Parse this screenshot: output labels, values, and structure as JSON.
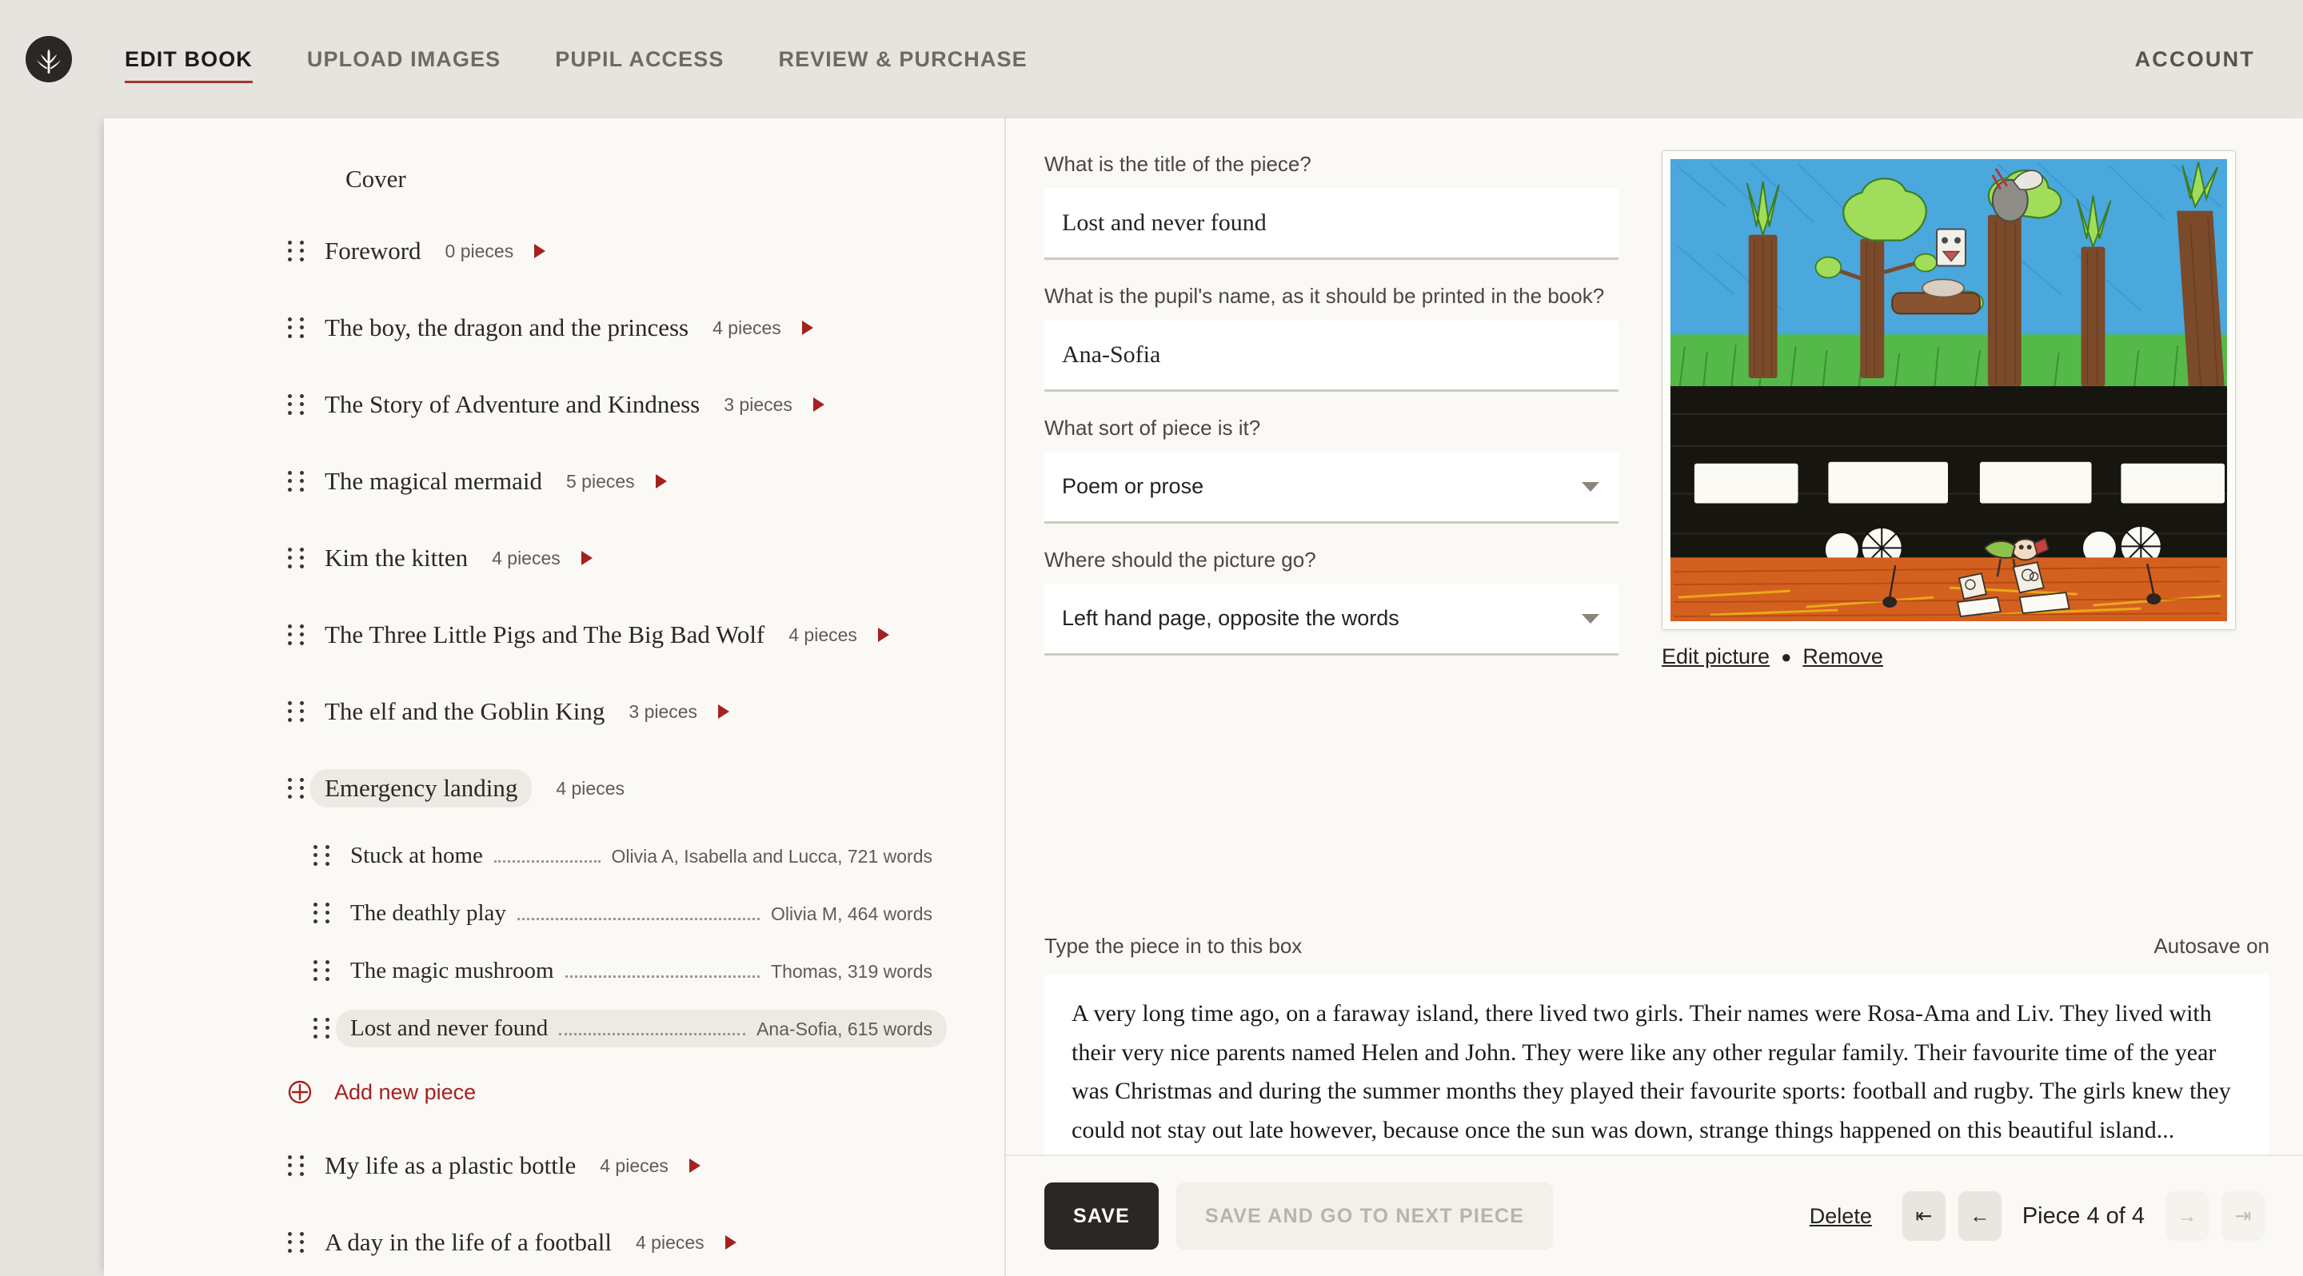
{
  "brand": {
    "logo_icon": "wheat-sheaf-logo"
  },
  "nav": {
    "items": [
      {
        "label": "EDIT BOOK",
        "active": true
      },
      {
        "label": "UPLOAD IMAGES",
        "active": false
      },
      {
        "label": "PUPIL ACCESS",
        "active": false
      },
      {
        "label": "REVIEW & PURCHASE",
        "active": false
      }
    ],
    "account_label": "ACCOUNT"
  },
  "sidebar": {
    "cover_label": "Cover",
    "add_piece_label": "Add new piece",
    "chapters": [
      {
        "title": "Foreword",
        "count": "0 pieces",
        "expanded": false,
        "selected": false
      },
      {
        "title": "The boy, the dragon and the princess",
        "count": "4 pieces",
        "expanded": false,
        "selected": false
      },
      {
        "title": "The Story of Adventure and Kindness",
        "count": "3 pieces",
        "expanded": false,
        "selected": false
      },
      {
        "title": "The magical mermaid",
        "count": "5 pieces",
        "expanded": false,
        "selected": false
      },
      {
        "title": "Kim the kitten",
        "count": "4 pieces",
        "expanded": false,
        "selected": false
      },
      {
        "title": "The Three Little Pigs and The Big Bad Wolf",
        "count": "4 pieces",
        "expanded": false,
        "selected": false
      },
      {
        "title": "The elf and the Goblin King",
        "count": "3 pieces",
        "expanded": false,
        "selected": false
      },
      {
        "title": "Emergency landing",
        "count": "4 pieces",
        "expanded": true,
        "selected": true
      },
      {
        "title": "My life as a plastic bottle",
        "count": "4 pieces",
        "expanded": false,
        "selected": false
      },
      {
        "title": "A day in the life of a football",
        "count": "4 pieces",
        "expanded": false,
        "selected": false
      }
    ],
    "pieces": [
      {
        "title": "Stuck at home",
        "meta": "Olivia A, Isabella and Lucca, 721 words",
        "selected": false
      },
      {
        "title": "The deathly play",
        "meta": "Olivia M, 464 words",
        "selected": false
      },
      {
        "title": "The magic mushroom",
        "meta": "Thomas, 319 words",
        "selected": false
      },
      {
        "title": "Lost and never found",
        "meta": "Ana-Sofia, 615 words",
        "selected": true
      }
    ]
  },
  "form": {
    "title_label": "What is the title of the piece?",
    "title_value": "Lost and never found",
    "pupil_label": "What is the pupil's name, as it should be printed in the book?",
    "pupil_value": "Ana-Sofia",
    "sort_label": "What sort of piece is it?",
    "sort_value": "Poem or prose",
    "picture_label": "Where should the picture go?",
    "picture_value": "Left hand page, opposite the words"
  },
  "picture": {
    "edit_label": "Edit picture",
    "separator": "●",
    "remove_label": "Remove"
  },
  "editor": {
    "box_label": "Type the piece in to this box",
    "autosave_label": "Autosave on",
    "body": "A very long time ago, on a faraway island, there lived two girls. Their names were Rosa-Ama and Liv. They lived with their very nice parents named Helen and John. They were like any other regular family. Their favourite time of the year was Christmas and during the summer months they played their favourite sports: football and rugby. The girls knew they could not stay out late however, because once the sun was down, strange things happened on this beautiful island..."
  },
  "bottombar": {
    "save_label": "SAVE",
    "save_next_label": "SAVE AND GO TO NEXT PIECE",
    "delete_label": "Delete",
    "page_label": "Piece 4 of 4",
    "first_icon": "⇤",
    "prev_icon": "←",
    "next_icon": "→",
    "last_icon": "⇥"
  },
  "colors": {
    "accent_red": "#a3221f",
    "page_bg": "#e6e4df",
    "panel_bg": "#faf9f6",
    "dark": "#2b2724"
  }
}
